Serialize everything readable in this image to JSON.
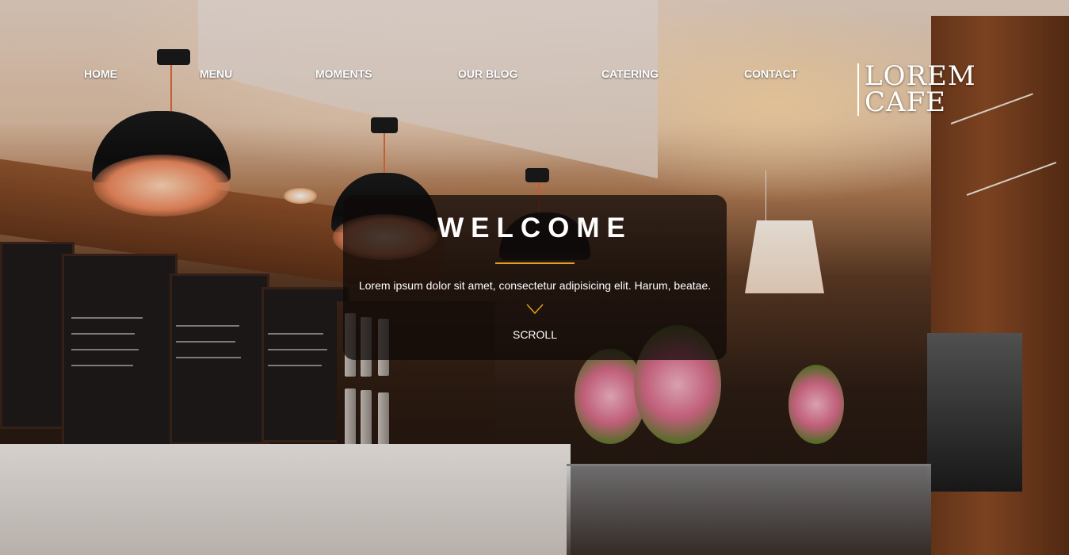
{
  "nav": {
    "items": [
      {
        "label": "HOME"
      },
      {
        "label": "MENU"
      },
      {
        "label": "MOMENTS"
      },
      {
        "label": "OUR BLOG"
      },
      {
        "label": "CATERING"
      },
      {
        "label": "CONTACT"
      }
    ]
  },
  "logo": {
    "line1": "LOREM",
    "line2": "CAFE"
  },
  "hero": {
    "title": "WELCOME",
    "text": "Lorem ipsum dolor sit amet, consectetur adipisicing elit. Harum, beatae.",
    "scroll_label": "SCROLL",
    "scroll_icon": "chevron-down-icon",
    "accent_color": "#e0a020"
  }
}
